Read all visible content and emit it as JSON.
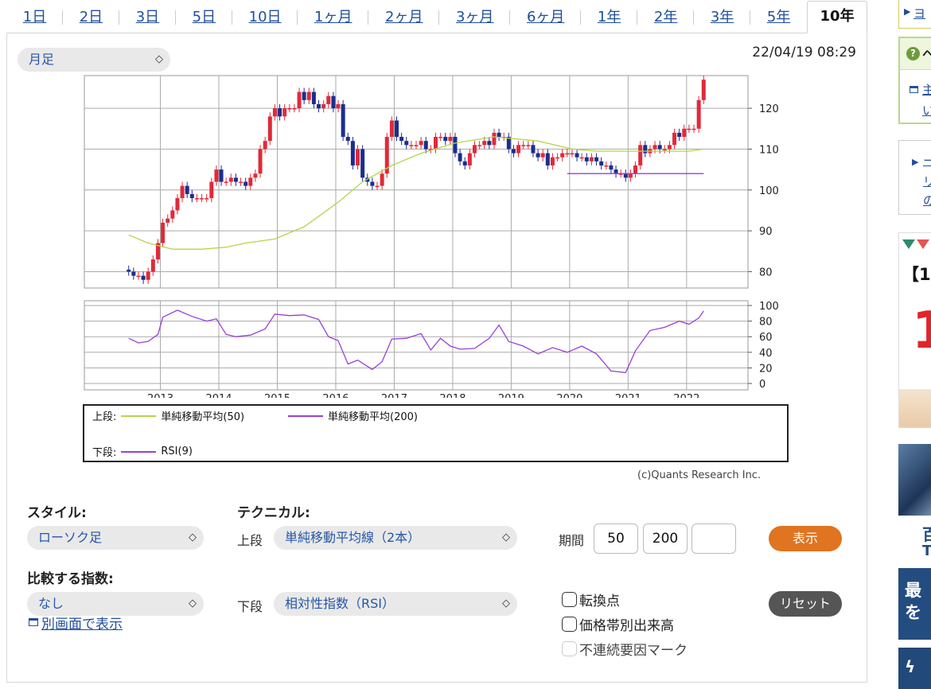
{
  "tabs": [
    {
      "label": "1日"
    },
    {
      "label": "2日"
    },
    {
      "label": "3日"
    },
    {
      "label": "5日"
    },
    {
      "label": "10日"
    },
    {
      "label": "1ヶ月"
    },
    {
      "label": "2ヶ月"
    },
    {
      "label": "3ヶ月"
    },
    {
      "label": "6ヶ月"
    },
    {
      "label": "1年"
    },
    {
      "label": "2年"
    },
    {
      "label": "3年"
    },
    {
      "label": "5年"
    },
    {
      "label": "10年",
      "active": true
    }
  ],
  "interval_select": {
    "value": "月足"
  },
  "timestamp": "22/04/19 08:29",
  "chart_data": [
    {
      "type": "candlestick",
      "title": "",
      "x_ticks": [
        "2013",
        "2014",
        "2015",
        "2016",
        "2017",
        "2018",
        "2019",
        "2020",
        "2021",
        "2022"
      ],
      "y_ticks": [
        80,
        90,
        100,
        110,
        120
      ],
      "ylim": [
        76,
        128
      ],
      "xlim": [
        2011.7,
        2023.05
      ],
      "grid": true,
      "monthly_close": [
        {
          "date": "2012-06",
          "value": 80
        },
        {
          "date": "2012-07",
          "value": 79
        },
        {
          "date": "2012-08",
          "value": 79
        },
        {
          "date": "2012-09",
          "value": 78
        },
        {
          "date": "2012-10",
          "value": 80
        },
        {
          "date": "2012-11",
          "value": 83
        },
        {
          "date": "2012-12",
          "value": 87
        },
        {
          "date": "2013-01",
          "value": 92
        },
        {
          "date": "2013-02",
          "value": 93
        },
        {
          "date": "2013-03",
          "value": 95
        },
        {
          "date": "2013-04",
          "value": 98
        },
        {
          "date": "2013-05",
          "value": 101
        },
        {
          "date": "2013-06",
          "value": 99
        },
        {
          "date": "2013-07",
          "value": 98
        },
        {
          "date": "2013-08",
          "value": 98
        },
        {
          "date": "2013-09",
          "value": 98
        },
        {
          "date": "2013-10",
          "value": 98
        },
        {
          "date": "2013-11",
          "value": 102
        },
        {
          "date": "2013-12",
          "value": 105
        },
        {
          "date": "2014-01",
          "value": 102
        },
        {
          "date": "2014-02",
          "value": 102
        },
        {
          "date": "2014-03",
          "value": 103
        },
        {
          "date": "2014-04",
          "value": 102
        },
        {
          "date": "2014-05",
          "value": 102
        },
        {
          "date": "2014-06",
          "value": 101
        },
        {
          "date": "2014-07",
          "value": 103
        },
        {
          "date": "2014-08",
          "value": 104
        },
        {
          "date": "2014-09",
          "value": 110
        },
        {
          "date": "2014-10",
          "value": 112
        },
        {
          "date": "2014-11",
          "value": 118
        },
        {
          "date": "2014-12",
          "value": 120
        },
        {
          "date": "2015-01",
          "value": 118
        },
        {
          "date": "2015-02",
          "value": 120
        },
        {
          "date": "2015-03",
          "value": 120
        },
        {
          "date": "2015-04",
          "value": 120
        },
        {
          "date": "2015-05",
          "value": 124
        },
        {
          "date": "2015-06",
          "value": 122
        },
        {
          "date": "2015-07",
          "value": 124
        },
        {
          "date": "2015-08",
          "value": 121
        },
        {
          "date": "2015-09",
          "value": 120
        },
        {
          "date": "2015-10",
          "value": 121
        },
        {
          "date": "2015-11",
          "value": 123
        },
        {
          "date": "2015-12",
          "value": 120
        },
        {
          "date": "2016-01",
          "value": 121
        },
        {
          "date": "2016-02",
          "value": 113
        },
        {
          "date": "2016-03",
          "value": 112
        },
        {
          "date": "2016-04",
          "value": 106
        },
        {
          "date": "2016-05",
          "value": 110
        },
        {
          "date": "2016-06",
          "value": 103
        },
        {
          "date": "2016-07",
          "value": 102
        },
        {
          "date": "2016-08",
          "value": 101
        },
        {
          "date": "2016-09",
          "value": 101
        },
        {
          "date": "2016-10",
          "value": 104
        },
        {
          "date": "2016-11",
          "value": 113
        },
        {
          "date": "2016-12",
          "value": 117
        },
        {
          "date": "2017-01",
          "value": 113
        },
        {
          "date": "2017-02",
          "value": 112
        },
        {
          "date": "2017-03",
          "value": 111
        },
        {
          "date": "2017-04",
          "value": 111
        },
        {
          "date": "2017-05",
          "value": 111
        },
        {
          "date": "2017-06",
          "value": 112
        },
        {
          "date": "2017-07",
          "value": 110
        },
        {
          "date": "2017-08",
          "value": 110
        },
        {
          "date": "2017-09",
          "value": 113
        },
        {
          "date": "2017-10",
          "value": 113
        },
        {
          "date": "2017-11",
          "value": 112
        },
        {
          "date": "2017-12",
          "value": 113
        },
        {
          "date": "2018-01",
          "value": 109
        },
        {
          "date": "2018-02",
          "value": 107
        },
        {
          "date": "2018-03",
          "value": 106
        },
        {
          "date": "2018-04",
          "value": 109
        },
        {
          "date": "2018-05",
          "value": 111
        },
        {
          "date": "2018-06",
          "value": 111
        },
        {
          "date": "2018-07",
          "value": 112
        },
        {
          "date": "2018-08",
          "value": 111
        },
        {
          "date": "2018-09",
          "value": 114
        },
        {
          "date": "2018-10",
          "value": 113
        },
        {
          "date": "2018-11",
          "value": 113
        },
        {
          "date": "2018-12",
          "value": 110
        },
        {
          "date": "2019-01",
          "value": 109
        },
        {
          "date": "2019-02",
          "value": 111
        },
        {
          "date": "2019-03",
          "value": 111
        },
        {
          "date": "2019-04",
          "value": 111
        },
        {
          "date": "2019-05",
          "value": 109
        },
        {
          "date": "2019-06",
          "value": 108
        },
        {
          "date": "2019-07",
          "value": 109
        },
        {
          "date": "2019-08",
          "value": 106
        },
        {
          "date": "2019-09",
          "value": 108
        },
        {
          "date": "2019-10",
          "value": 108
        },
        {
          "date": "2019-11",
          "value": 109
        },
        {
          "date": "2019-12",
          "value": 109
        },
        {
          "date": "2020-01",
          "value": 109
        },
        {
          "date": "2020-02",
          "value": 108
        },
        {
          "date": "2020-03",
          "value": 108
        },
        {
          "date": "2020-04",
          "value": 107
        },
        {
          "date": "2020-05",
          "value": 108
        },
        {
          "date": "2020-06",
          "value": 107
        },
        {
          "date": "2020-07",
          "value": 106
        },
        {
          "date": "2020-08",
          "value": 106
        },
        {
          "date": "2020-09",
          "value": 105
        },
        {
          "date": "2020-10",
          "value": 104
        },
        {
          "date": "2020-11",
          "value": 104
        },
        {
          "date": "2020-12",
          "value": 103
        },
        {
          "date": "2021-01",
          "value": 104
        },
        {
          "date": "2021-02",
          "value": 106
        },
        {
          "date": "2021-03",
          "value": 111
        },
        {
          "date": "2021-04",
          "value": 109
        },
        {
          "date": "2021-05",
          "value": 110
        },
        {
          "date": "2021-06",
          "value": 111
        },
        {
          "date": "2021-07",
          "value": 110
        },
        {
          "date": "2021-08",
          "value": 110
        },
        {
          "date": "2021-09",
          "value": 111
        },
        {
          "date": "2021-10",
          "value": 114
        },
        {
          "date": "2021-11",
          "value": 113
        },
        {
          "date": "2021-12",
          "value": 115
        },
        {
          "date": "2022-01",
          "value": 115
        },
        {
          "date": "2022-02",
          "value": 115
        },
        {
          "date": "2022-03",
          "value": 122
        },
        {
          "date": "2022-04",
          "value": 127
        }
      ],
      "sma50": [
        {
          "date": "2012-06",
          "value": 89
        },
        {
          "date": "2012-10",
          "value": 87
        },
        {
          "date": "2013-03",
          "value": 85.5
        },
        {
          "date": "2013-09",
          "value": 85.5
        },
        {
          "date": "2014-02",
          "value": 86
        },
        {
          "date": "2014-06",
          "value": 87
        },
        {
          "date": "2014-12",
          "value": 88
        },
        {
          "date": "2015-06",
          "value": 91
        },
        {
          "date": "2016-01",
          "value": 97
        },
        {
          "date": "2016-06",
          "value": 102
        },
        {
          "date": "2016-12",
          "value": 106
        },
        {
          "date": "2017-06",
          "value": 109
        },
        {
          "date": "2018-01",
          "value": 111.5
        },
        {
          "date": "2018-09",
          "value": 113
        },
        {
          "date": "2019-06",
          "value": 112
        },
        {
          "date": "2020-01",
          "value": 110
        },
        {
          "date": "2020-06",
          "value": 109.5
        },
        {
          "date": "2021-01",
          "value": 109.5
        },
        {
          "date": "2021-06",
          "value": 109.5
        },
        {
          "date": "2022-01",
          "value": 109.5
        },
        {
          "date": "2022-04",
          "value": 110
        }
      ],
      "sma200": [
        {
          "date": "2019-12",
          "value": 104
        },
        {
          "date": "2020-06",
          "value": 104
        },
        {
          "date": "2021-01",
          "value": 104
        },
        {
          "date": "2021-06",
          "value": 104
        },
        {
          "date": "2022-01",
          "value": 104
        },
        {
          "date": "2022-04",
          "value": 104
        }
      ]
    },
    {
      "type": "line",
      "title": "",
      "x_ticks": [
        "2013",
        "2014",
        "2015",
        "2016",
        "2017",
        "2018",
        "2019",
        "2020",
        "2021",
        "2022"
      ],
      "y_ticks": [
        0,
        20,
        40,
        60,
        80,
        100
      ],
      "ylim": [
        0,
        100
      ],
      "grid": true,
      "series": [
        {
          "name": "RSI(9)",
          "points": [
            {
              "date": "2012-06",
              "value": 58
            },
            {
              "date": "2012-08",
              "value": 52
            },
            {
              "date": "2012-10",
              "value": 54
            },
            {
              "date": "2012-12",
              "value": 63
            },
            {
              "date": "2013-01",
              "value": 85
            },
            {
              "date": "2013-04",
              "value": 94
            },
            {
              "date": "2013-07",
              "value": 86
            },
            {
              "date": "2013-10",
              "value": 80
            },
            {
              "date": "2013-12",
              "value": 83
            },
            {
              "date": "2014-02",
              "value": 63
            },
            {
              "date": "2014-04",
              "value": 60
            },
            {
              "date": "2014-07",
              "value": 62
            },
            {
              "date": "2014-10",
              "value": 70
            },
            {
              "date": "2014-12",
              "value": 89
            },
            {
              "date": "2015-03",
              "value": 87
            },
            {
              "date": "2015-06",
              "value": 88
            },
            {
              "date": "2015-09",
              "value": 82
            },
            {
              "date": "2015-11",
              "value": 60
            },
            {
              "date": "2016-01",
              "value": 55
            },
            {
              "date": "2016-03",
              "value": 25
            },
            {
              "date": "2016-05",
              "value": 30
            },
            {
              "date": "2016-08",
              "value": 18
            },
            {
              "date": "2016-10",
              "value": 28
            },
            {
              "date": "2016-12",
              "value": 57
            },
            {
              "date": "2017-03",
              "value": 58
            },
            {
              "date": "2017-06",
              "value": 64
            },
            {
              "date": "2017-08",
              "value": 43
            },
            {
              "date": "2017-10",
              "value": 58
            },
            {
              "date": "2017-12",
              "value": 48
            },
            {
              "date": "2018-02",
              "value": 44
            },
            {
              "date": "2018-05",
              "value": 45
            },
            {
              "date": "2018-08",
              "value": 58
            },
            {
              "date": "2018-10",
              "value": 75
            },
            {
              "date": "2018-12",
              "value": 54
            },
            {
              "date": "2019-03",
              "value": 48
            },
            {
              "date": "2019-06",
              "value": 38
            },
            {
              "date": "2019-09",
              "value": 46
            },
            {
              "date": "2019-12",
              "value": 40
            },
            {
              "date": "2020-03",
              "value": 48
            },
            {
              "date": "2020-06",
              "value": 38
            },
            {
              "date": "2020-09",
              "value": 16
            },
            {
              "date": "2020-12",
              "value": 14
            },
            {
              "date": "2021-02",
              "value": 42
            },
            {
              "date": "2021-05",
              "value": 68
            },
            {
              "date": "2021-08",
              "value": 72
            },
            {
              "date": "2021-11",
              "value": 80
            },
            {
              "date": "2022-01",
              "value": 76
            },
            {
              "date": "2022-03",
              "value": 84
            },
            {
              "date": "2022-04",
              "value": 93
            }
          ]
        }
      ]
    }
  ],
  "legend": {
    "upper_label": "上段:",
    "lower_label": "下段:",
    "sma50": "単純移動平均(50)",
    "sma200": "単純移動平均(200)",
    "rsi": "RSI(9)",
    "sma50_color": "#b5d44b",
    "sma200_color": "#9a3fd8",
    "rsi_color": "#9a3fd8"
  },
  "credit": "(c)Quants Research Inc.",
  "controls": {
    "style_label": "スタイル:",
    "style_value": "ローソク足",
    "technical_label": "テクニカル:",
    "upper_label": "上段",
    "upper_value": "単純移動平均線（2本）",
    "period_label": "期間",
    "period1": "50",
    "period2": "200",
    "period3": "",
    "show_button": "表示",
    "compare_label": "比較する指数:",
    "compare_value": "なし",
    "lower_label": "下段",
    "lower_value": "相対性指数（RSI）",
    "check1": "転換点",
    "check2": "価格帯別出来高",
    "check3": "不連続要因マーク",
    "reset_button": "リセット",
    "new_window": "別画面で表示"
  },
  "colors": {
    "accent": "#e07420",
    "link": "#1f4f9c",
    "up": "#e02a3a",
    "down": "#1c2d8f",
    "reset": "#555555"
  },
  "sidebar": {
    "link1": "ヨ",
    "link2_a": "ヘ",
    "link2_b": "主",
    "link2_c": "い",
    "link3_a": "ー",
    "link3_b": "リ",
    "link3_c": "の",
    "ad1_text": "【1",
    "ad1_big": "1",
    "ad2_text1": "最",
    "ad2_text2": "を",
    "ad2_top": "百",
    "ad2_t": "T"
  }
}
